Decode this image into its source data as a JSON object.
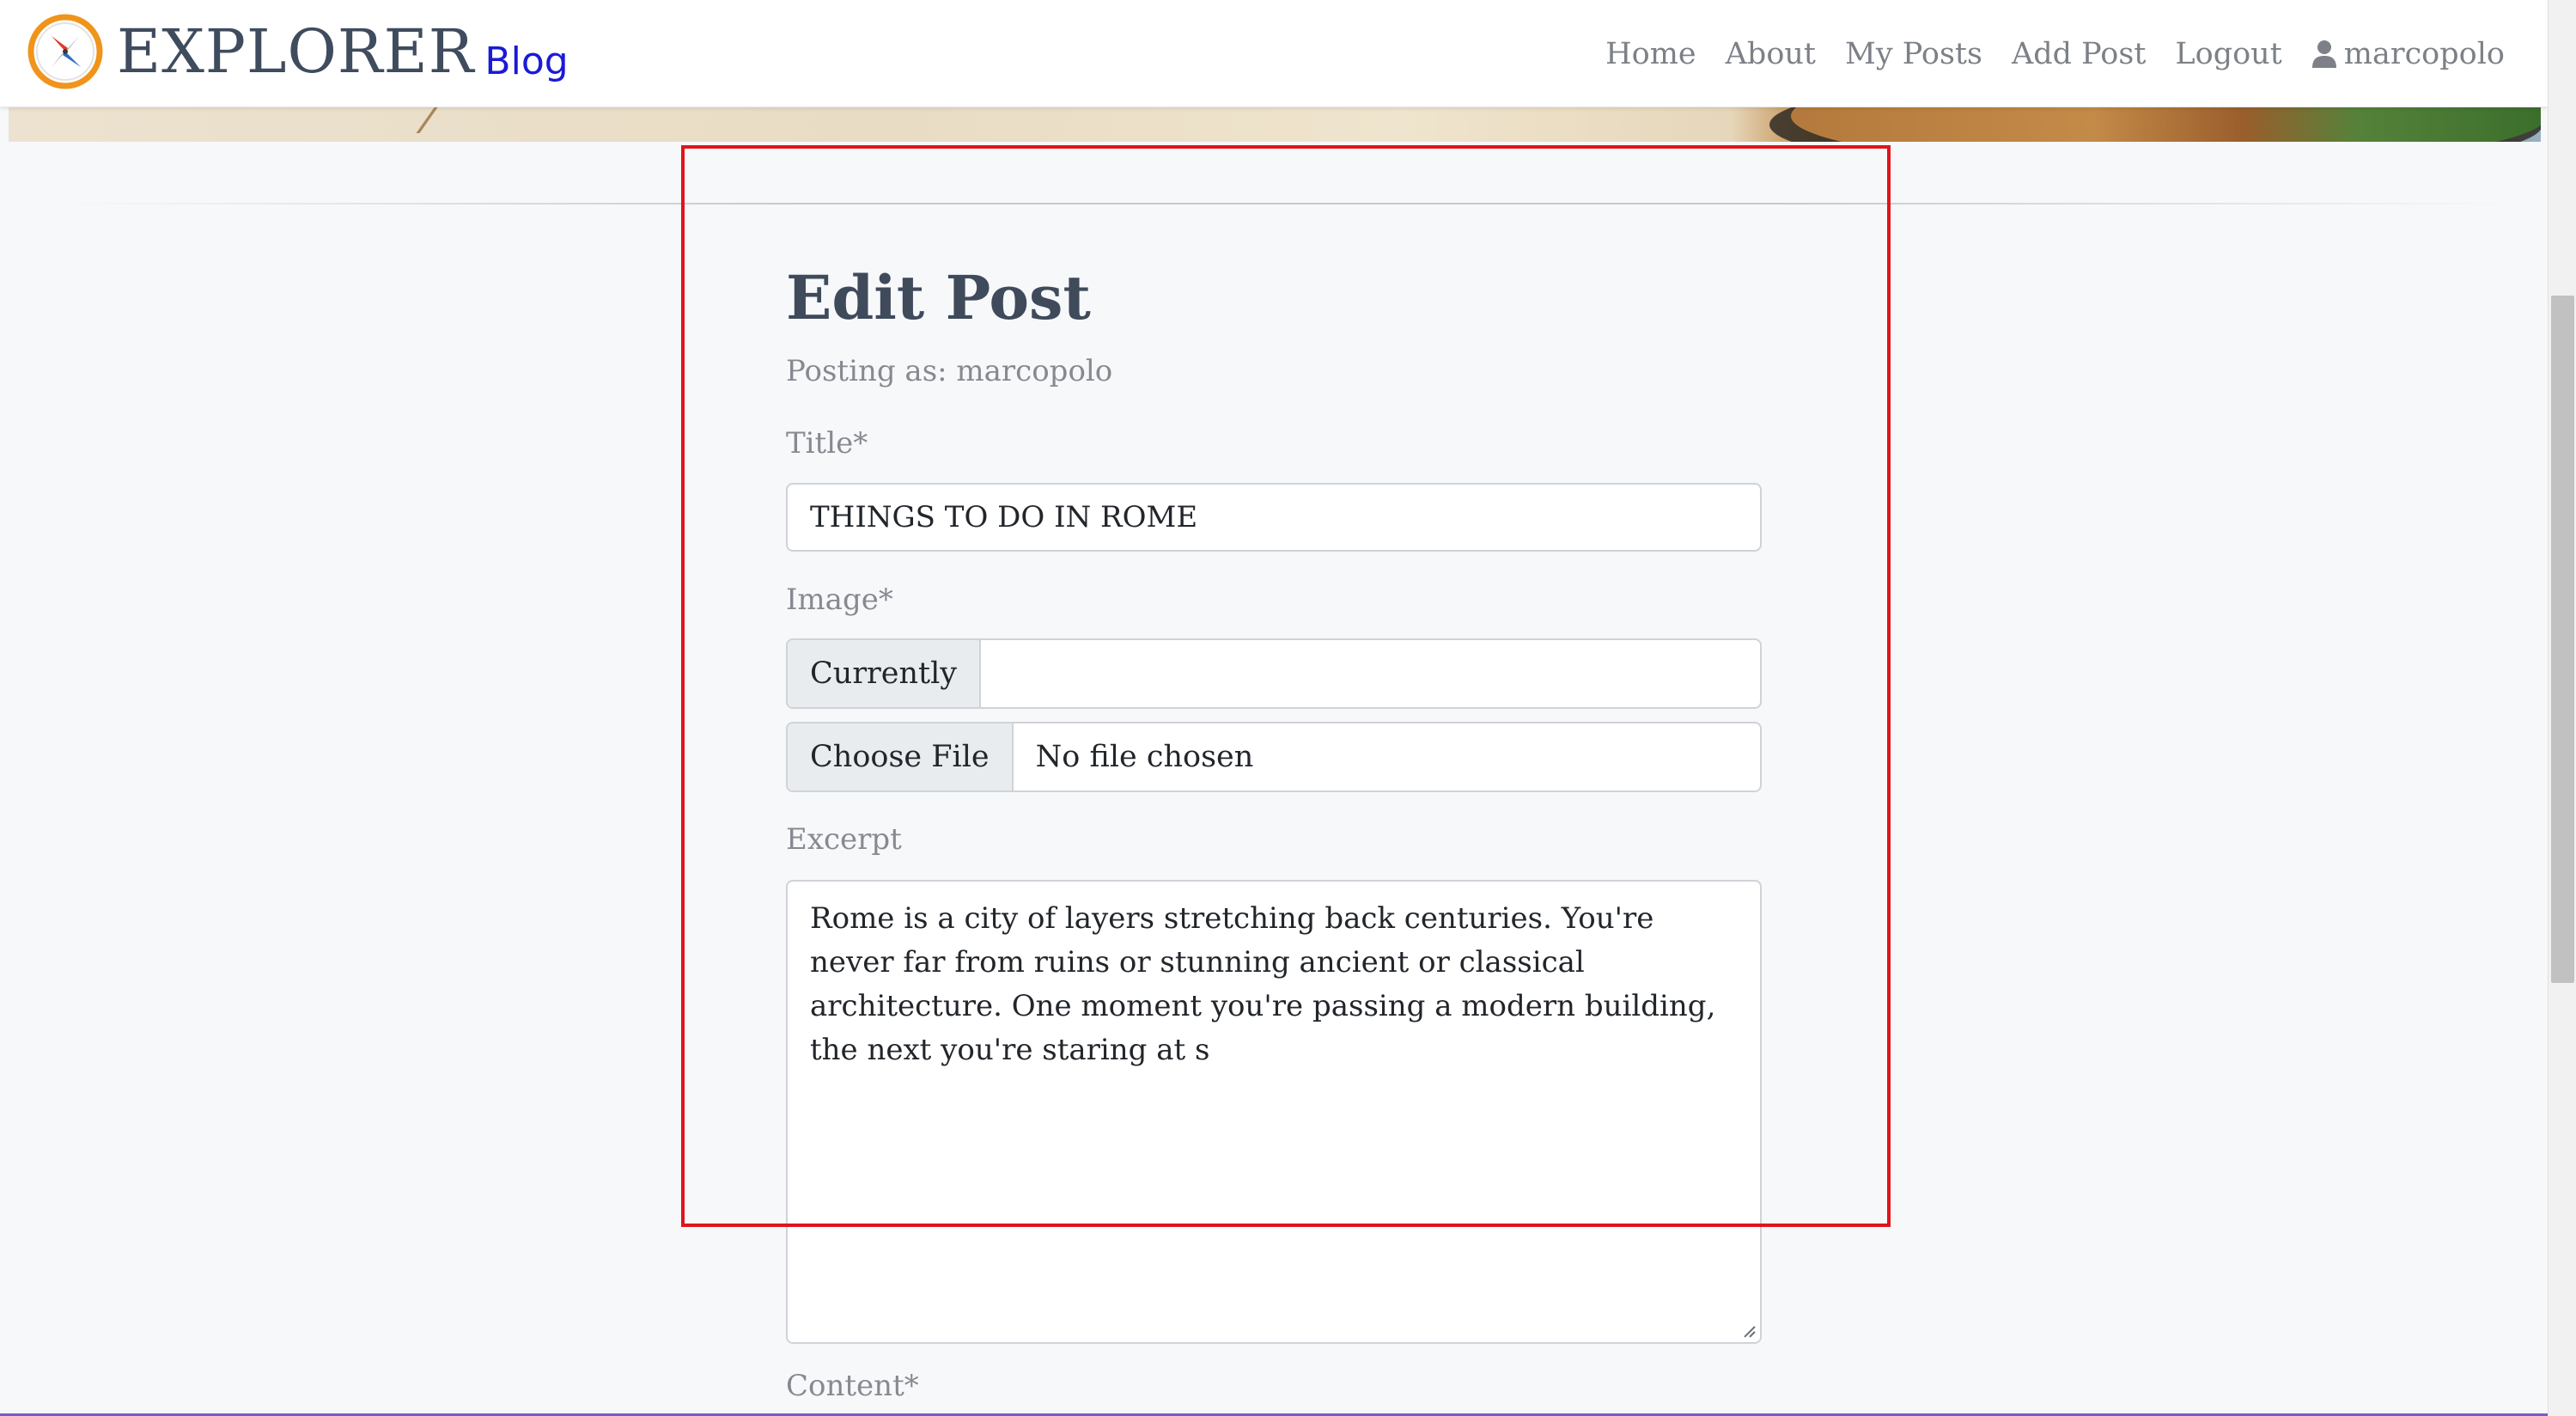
{
  "navbar": {
    "brand_name": "EXPLORER",
    "brand_tag": "Blog",
    "links": [
      "Home",
      "About",
      "My Posts",
      "Add Post",
      "Logout"
    ],
    "username": "marcopolo"
  },
  "form": {
    "heading": "Edit Post",
    "posting_as": "Posting as: marcopolo",
    "title_label": "Title*",
    "title_value": "THINGS TO DO IN ROME",
    "image_label": "Image*",
    "currently_label": "Currently",
    "currently_value": "",
    "choose_file_label": "Choose File",
    "file_status": "No file chosen",
    "excerpt_label": "Excerpt",
    "excerpt_value": "Rome is a city of layers stretching back centuries. You're never far from ruins or stunning ancient or classical architecture. One moment you're passing a modern building, the next you're staring at s",
    "content_label": "Content*"
  },
  "colors": {
    "brand_text": "#3f4c5e",
    "brand_tag": "#1a1ad6",
    "nav_link": "#7d8187",
    "highlight_border": "#e0141c",
    "page_bg": "#f7f8fa"
  },
  "icons": {
    "logo": "compass-icon",
    "user": "user-icon",
    "resize": "resize-grip-icon"
  }
}
